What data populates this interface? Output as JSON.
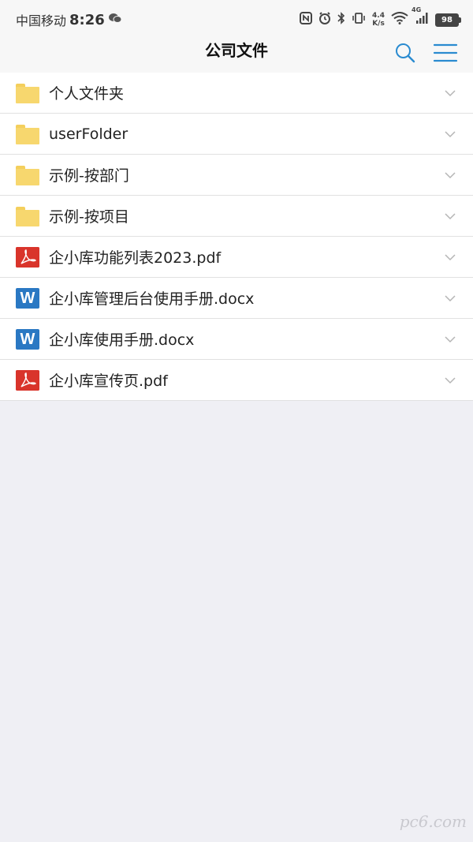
{
  "status_bar": {
    "carrier": "中国移动",
    "time": "8:26",
    "speed_value": "4.4",
    "speed_unit": "K/s",
    "network": "4G",
    "battery": "98"
  },
  "header": {
    "title": "公司文件",
    "search_icon": "search-icon",
    "menu_icon": "menu-icon",
    "accent_color": "#2a8bd0"
  },
  "files": [
    {
      "name": "个人文件夹",
      "type": "folder"
    },
    {
      "name": "userFolder",
      "type": "folder"
    },
    {
      "name": "示例-按部门",
      "type": "folder"
    },
    {
      "name": "示例-按项目",
      "type": "folder"
    },
    {
      "name": "企小库功能列表2023.pdf",
      "type": "pdf"
    },
    {
      "name": "企小库管理后台使用手册.docx",
      "type": "docx"
    },
    {
      "name": "企小库使用手册.docx",
      "type": "docx"
    },
    {
      "name": "企小库宣传页.pdf",
      "type": "pdf"
    }
  ],
  "watermark": "pc6.com"
}
